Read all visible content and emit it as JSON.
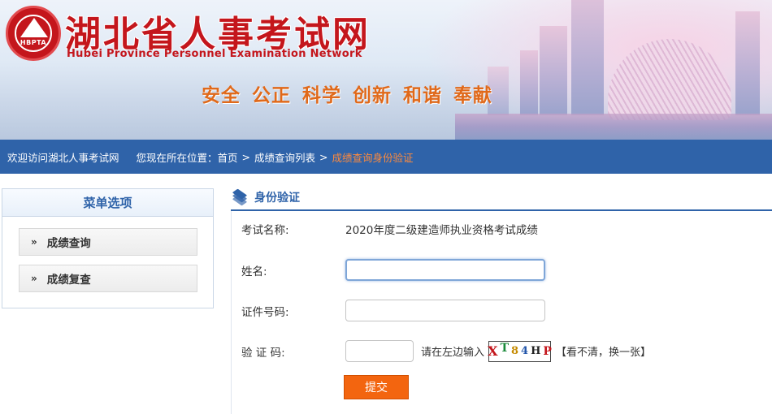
{
  "header": {
    "logo_abbr": "HBPTA",
    "title": "湖北省人事考试网",
    "subtitle": "Hubei Province Personnel Examination Network",
    "slogans": [
      "安全",
      "公正",
      "科学",
      "创新",
      "和谐",
      "奉献"
    ]
  },
  "nav": {
    "welcome": "欢迎访问湖北人事考试网",
    "location_label": "您现在所在位置：",
    "breadcrumb": [
      "首页",
      "成绩查询列表",
      "成绩查询身份验证"
    ],
    "separator": ">"
  },
  "sidebar": {
    "title": "菜单选项",
    "items": [
      {
        "arrow": "»",
        "label": "成绩查询"
      },
      {
        "arrow": "»",
        "label": "成绩复查"
      }
    ]
  },
  "form": {
    "section_title": "身份验证",
    "exam_label": "考试名称:",
    "exam_name": "2020年度二级建造师执业资格考试成绩",
    "name_label": "姓名:",
    "name_value": "",
    "id_label": "证件号码:",
    "id_value": "",
    "captcha_label": "验 证 码:",
    "captcha_value": "",
    "captcha_hint": "请在左边输入",
    "captcha_chars": [
      "X",
      "T",
      "8",
      "4",
      "H",
      "P"
    ],
    "captcha_refresh": "【看不清，换一张】",
    "submit_label": "提交"
  },
  "colors": {
    "brand_red": "#c4161c",
    "nav_blue": "#2f63a9",
    "slogan_orange": "#e0691a",
    "crumb_current": "#ff8a3c",
    "submit_orange": "#f3650f"
  }
}
